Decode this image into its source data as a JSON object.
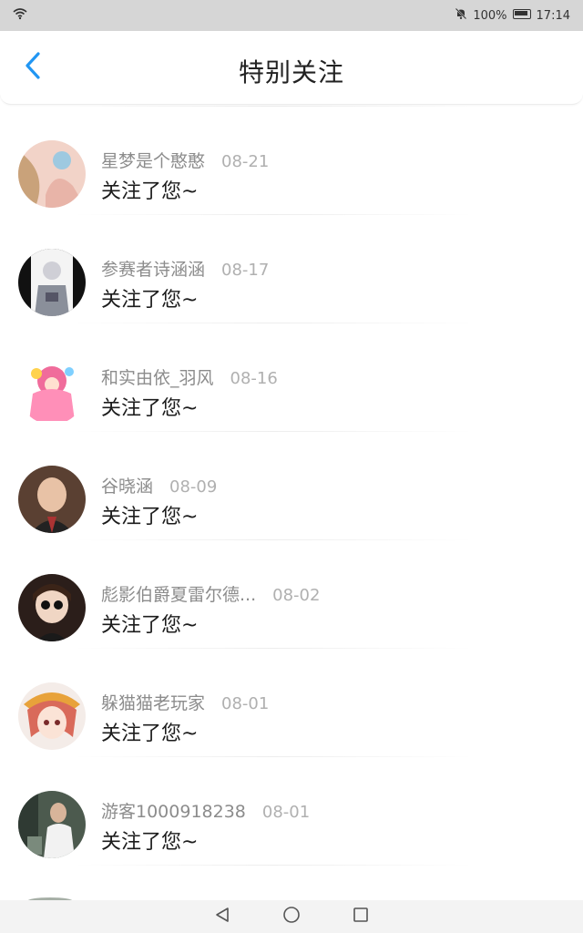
{
  "status": {
    "battery": "100%",
    "time": "17:14"
  },
  "header": {
    "title": "特别关注"
  },
  "items": [
    {
      "name": "星梦是个憨憨",
      "date": "08-21",
      "message": "关注了您~"
    },
    {
      "name": "参赛者诗涵涵",
      "date": "08-17",
      "message": "关注了您~"
    },
    {
      "name": "和实由依_羽风",
      "date": "08-16",
      "message": "关注了您~"
    },
    {
      "name": "谷晓涵",
      "date": "08-09",
      "message": "关注了您~"
    },
    {
      "name": "彪影伯爵夏雷尔德...",
      "date": "08-02",
      "message": "关注了您~"
    },
    {
      "name": "躲猫猫老玩家",
      "date": "08-01",
      "message": "关注了您~"
    },
    {
      "name": "游客1000918238",
      "date": "08-01",
      "message": "关注了您~"
    }
  ],
  "colors": {
    "accent": "#2196f3",
    "status_bar": "#d6d6d6"
  }
}
